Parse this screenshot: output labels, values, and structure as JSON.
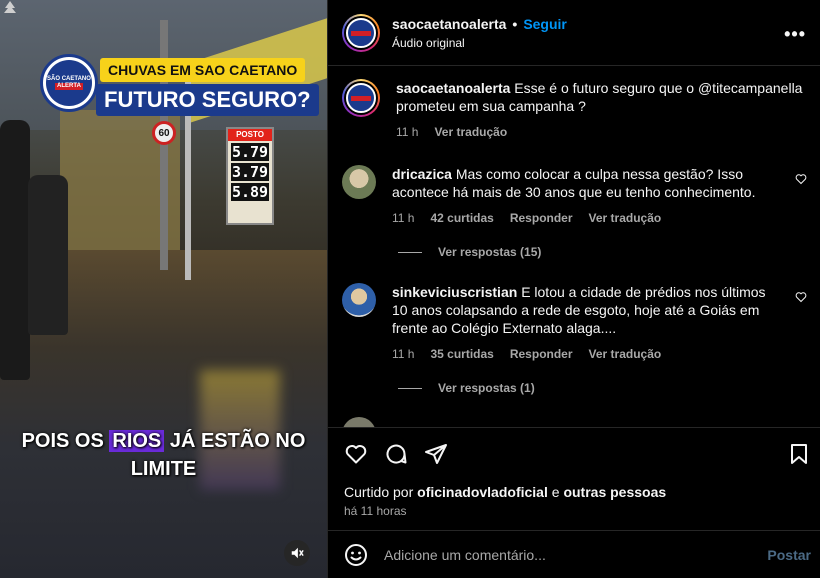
{
  "video": {
    "tag_line1": "CHUVAS EM SAO CAETANO",
    "tag_line2": "FUTURO SEGURO?",
    "logo_text_top": "SÃO CAETANO",
    "logo_text_bottom": "ALERTA",
    "speed_sign": "60",
    "price_header": "POSTO",
    "prices": [
      "5.79",
      "3.79",
      "5.89"
    ],
    "caption_part1": "POIS OS ",
    "caption_highlight": "RIOS",
    "caption_part2": " JÁ ESTÃO NO",
    "caption_line2": "LIMITE",
    "mute_icon": "speaker-muted-icon"
  },
  "post": {
    "username": "saocaetanoalerta",
    "separator": "•",
    "follow_label": "Seguir",
    "audio_label": "Áudio original",
    "more_icon": "•••"
  },
  "comments": [
    {
      "user": "saocaetanoalerta",
      "text": "Esse é o futuro seguro que o @titecampanella prometeu em sua campanha ?",
      "time": "11 h",
      "likes": "",
      "reply_label": "",
      "translate_label": "Ver tradução"
    },
    {
      "user": "dricazica",
      "text": "Mas como colocar a culpa nessa gestão? Isso acontece há mais de 30 anos que eu tenho conhecimento.",
      "time": "11 h",
      "likes": "42 curtidas",
      "reply_label": "Responder",
      "translate_label": "Ver tradução",
      "view_replies": "Ver respostas (15)"
    },
    {
      "user": "sinkeviciuscristian",
      "text": "E lotou a cidade de prédios nos últimos 10 anos colapsando a rede de esgoto, hoje até a Goiás em frente ao Colégio Externato alaga....",
      "time": "11 h",
      "likes": "35 curtidas",
      "reply_label": "Responder",
      "translate_label": "Ver tradução",
      "view_replies": "Ver respostas (1)"
    }
  ],
  "actions": {
    "liked_prefix": "Curtido por ",
    "liked_user": "oficinadovladoficial",
    "liked_and": " e ",
    "liked_others": "outras pessoas",
    "time_ago": "há 11 horas"
  },
  "composer": {
    "placeholder": "Adicione um comentário...",
    "post_label": "Postar"
  },
  "colors": {
    "accent": "#0095f6",
    "muted_text": "#a8a8a8",
    "brand_blue": "#1b3a8c",
    "brand_red": "#d21f26",
    "caption_highlight": "#6a2bd9"
  }
}
